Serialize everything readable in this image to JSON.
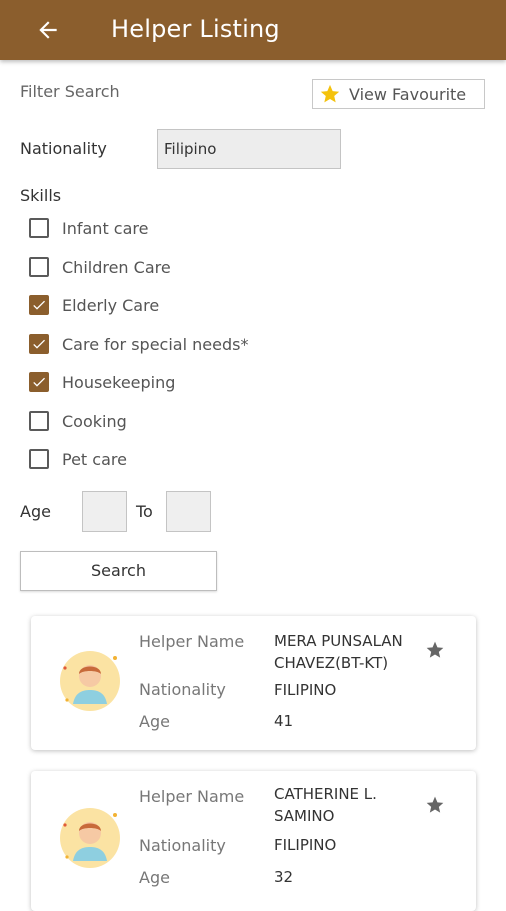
{
  "header": {
    "title": "Helper Listing",
    "back_icon": "arrow-left-icon"
  },
  "colors": {
    "brand": "#8b5e2d",
    "star_yellow": "#f4c20d",
    "star_grey": "#666666"
  },
  "filter": {
    "label": "Filter Search",
    "view_favourite_label": "View Favourite",
    "nationality_label": "Nationality",
    "nationality_value": "Filipino",
    "skills_label": "Skills",
    "skills": [
      {
        "label": "Infant care",
        "checked": false
      },
      {
        "label": "Children Care",
        "checked": false
      },
      {
        "label": "Elderly Care",
        "checked": true
      },
      {
        "label": "Care for special needs*",
        "checked": true
      },
      {
        "label": "Housekeeping",
        "checked": true
      },
      {
        "label": "Cooking",
        "checked": false
      },
      {
        "label": "Pet care",
        "checked": false
      }
    ],
    "age_label": "Age",
    "age_from": "",
    "to_label": "To",
    "age_to": "",
    "search_label": "Search"
  },
  "results": [
    {
      "name_label": "Helper Name",
      "name_line1": "MERA PUNSALAN",
      "name_line2": "CHAVEZ(BT-KT)",
      "nationality_label": "Nationality",
      "nationality": "FILIPINO",
      "age_label": "Age",
      "age": "41",
      "favourite": false
    },
    {
      "name_label": "Helper Name",
      "name_line1": "CATHERINE L.",
      "name_line2": "SAMINO",
      "nationality_label": "Nationality",
      "nationality": "FILIPINO",
      "age_label": "Age",
      "age": "32",
      "favourite": false
    }
  ]
}
